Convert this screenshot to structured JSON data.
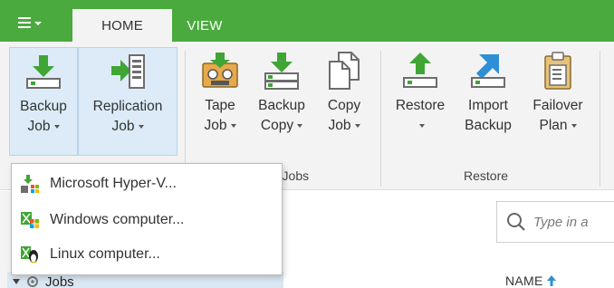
{
  "app": {
    "menu_icon": "hamburger-menu-icon",
    "accent_color": "#4aaa3e"
  },
  "tabs": [
    {
      "label": "HOME",
      "selected": true
    },
    {
      "label": "VIEW",
      "selected": false
    }
  ],
  "ribbon": {
    "buttons": [
      {
        "l1": "Backup",
        "l2": "Job",
        "icon": "backup-job-icon",
        "dropdown": true,
        "active": true
      },
      {
        "l1": "Replication",
        "l2": "Job",
        "icon": "replication-job-icon",
        "dropdown": true,
        "active": true
      },
      {
        "l1": "Tape",
        "l2": "Job",
        "icon": "tape-job-icon",
        "dropdown": true
      },
      {
        "l1": "Backup",
        "l2": "Copy",
        "icon": "backup-copy-icon",
        "dropdown": true
      },
      {
        "l1": "Copy",
        "l2": "Job",
        "icon": "copy-job-icon",
        "dropdown": true
      },
      {
        "l1": "Restore",
        "l2": "",
        "icon": "restore-icon",
        "dropdown": true
      },
      {
        "l1": "Import",
        "l2": "Backup",
        "icon": "import-backup-icon",
        "dropdown": false
      },
      {
        "l1": "Failover",
        "l2": "Plan",
        "icon": "failover-plan-icon",
        "dropdown": true
      }
    ],
    "groups": {
      "secondary_jobs_partial": "ry Jobs",
      "restore": "Restore"
    }
  },
  "dropdown_menu": {
    "items": [
      {
        "label": "Microsoft Hyper-V...",
        "icon": "hyper-v-icon"
      },
      {
        "label": "Windows computer...",
        "icon": "windows-computer-icon"
      },
      {
        "label": "Linux computer...",
        "icon": "linux-computer-icon"
      }
    ]
  },
  "nav": {
    "jobs_label": "Jobs"
  },
  "content": {
    "search_placeholder": "Type in a",
    "column_name": "NAME"
  }
}
